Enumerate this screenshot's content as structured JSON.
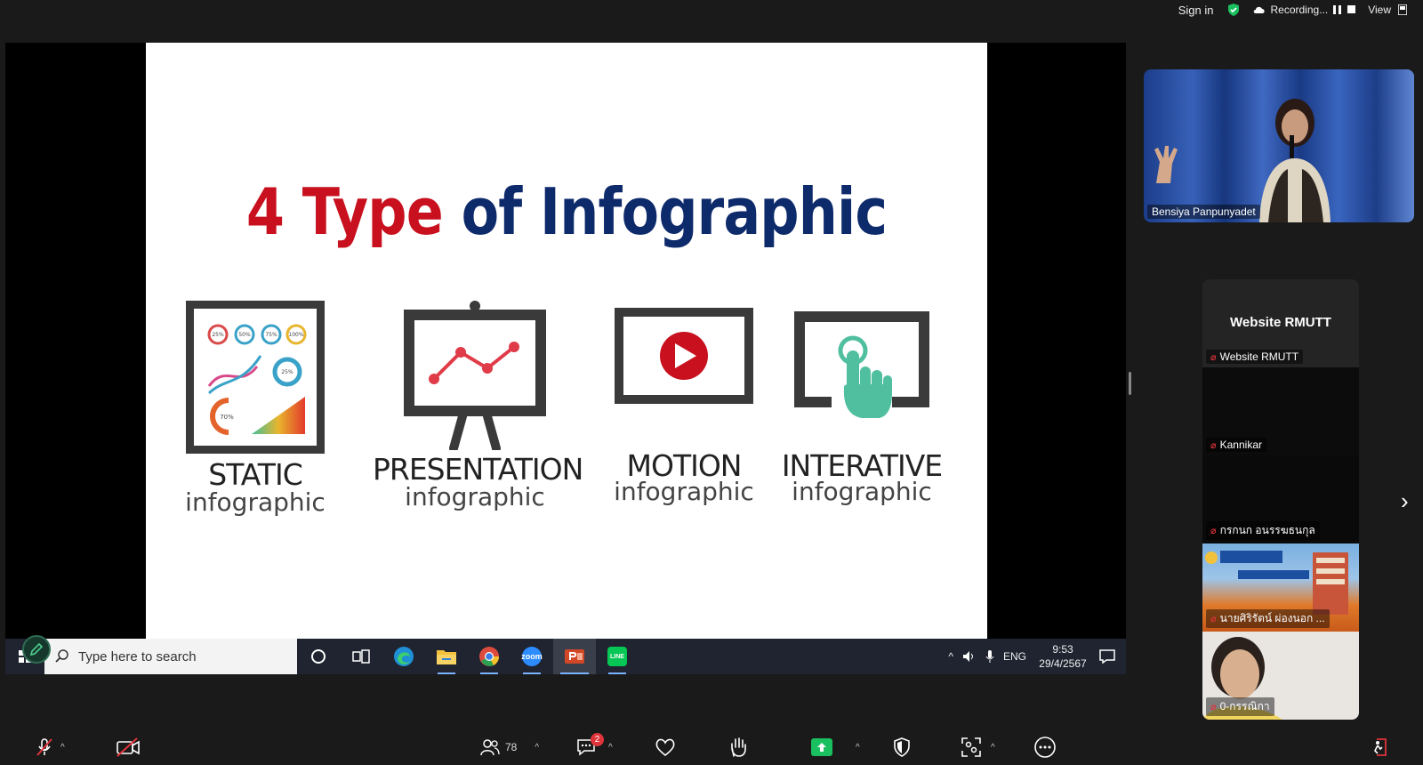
{
  "top_bar": {
    "sign_in": "Sign in",
    "recording_label": "Recording...",
    "view_label": "View"
  },
  "slide": {
    "title_part1": "4 Type",
    "title_part2": "of Infographic",
    "types": [
      {
        "name": "STATIC",
        "sub": "infographic"
      },
      {
        "name": "PRESENTATION",
        "sub": "infographic"
      },
      {
        "name": "MOTION",
        "sub": "infographic"
      },
      {
        "name": "INTERATIVE",
        "sub": "infographic"
      }
    ],
    "static_badges": [
      "25%",
      "50%",
      "75%",
      "100%"
    ],
    "static_ring": "25%",
    "static_gauge": "70%"
  },
  "taskbar": {
    "search_placeholder": "Type here to search",
    "apps": [
      "Task View",
      "Edge",
      "File Explorer",
      "Chrome",
      "Zoom",
      "PowerPoint",
      "LINE"
    ],
    "zoom_app_label": "zoom",
    "line_app_label": "LINE",
    "language": "ENG",
    "time": "9:53",
    "date": "29/4/2567"
  },
  "participants": {
    "speaker": "Bensiya Panpunyadet",
    "tiles": [
      {
        "title": "Website RMUTT",
        "name": "Website RMUTT"
      },
      {
        "name": "Kannikar"
      },
      {
        "name": "กรกนก อนรรฆธนกุล"
      },
      {
        "name": "นายศิริรัตน์ ผ่องนอก ..."
      },
      {
        "name": "0-กรรณิกา"
      }
    ]
  },
  "meeting_bar": {
    "participants_count": "78",
    "chat_badge": "2"
  },
  "colors": {
    "title_red": "#c8101e",
    "title_blue": "#0d2a6b",
    "share_green": "#1ac05f",
    "muted_red": "#e0343b",
    "accent_teal": "#4fbf9f"
  }
}
